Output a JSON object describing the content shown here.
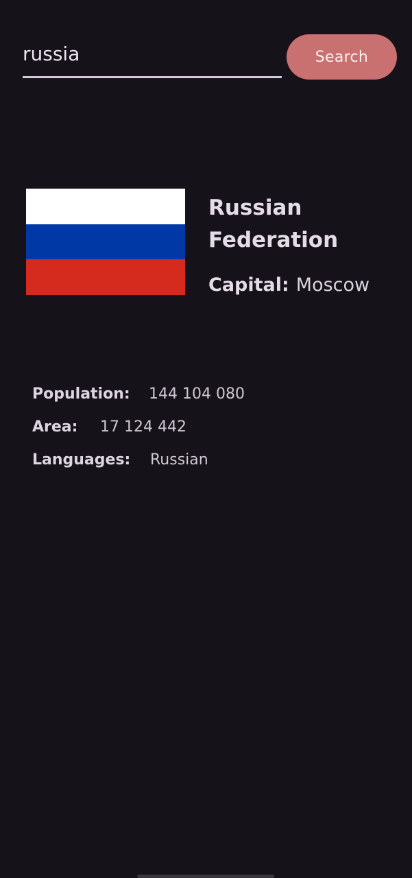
{
  "search": {
    "value": "russia",
    "button_label": "Search"
  },
  "country": {
    "name": "Russian Federation",
    "flag_colors": [
      "#ffffff",
      "#0039a6",
      "#d52b1e"
    ],
    "capital_label": "Capital:",
    "capital_value": "Moscow"
  },
  "details": [
    {
      "label": "Population:",
      "value": "144 104 080"
    },
    {
      "label": "Area:",
      "value": "17 124 442"
    },
    {
      "label": "Languages:",
      "value": "Russian"
    }
  ],
  "colors": {
    "background": "#151219",
    "accent": "#c97171"
  }
}
